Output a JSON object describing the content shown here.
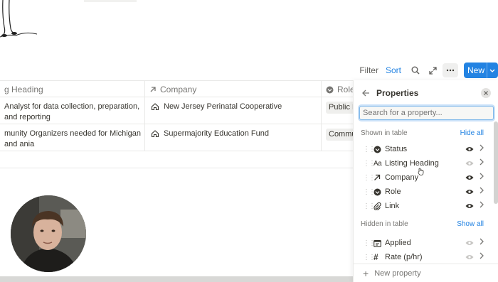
{
  "toolbar": {
    "filter": "Filter",
    "sort": "Sort",
    "new": "New"
  },
  "table": {
    "headers": [
      "g Heading",
      "Company",
      "Role"
    ],
    "rows": [
      {
        "heading": "Analyst for data collection, preparation, and reporting",
        "company": "New Jersey Perinatal Cooperative",
        "role": "Public H"
      },
      {
        "heading": "munity Organizers needed for Michigan and ania",
        "company": "Supermajority Education Fund",
        "role": "Commu"
      }
    ]
  },
  "panel": {
    "title": "Properties",
    "search_placeholder": "Search for a property...",
    "shown_label": "Shown in table",
    "hide_all": "Hide all",
    "hidden_label": "Hidden in table",
    "show_all": "Show all",
    "shown": [
      {
        "name": "Status",
        "icon": "status-icon"
      },
      {
        "name": "Listing Heading",
        "icon": "text-icon"
      },
      {
        "name": "Company",
        "icon": "relation-arrow-icon"
      },
      {
        "name": "Role",
        "icon": "status-icon"
      },
      {
        "name": "Link",
        "icon": "paperclip-icon"
      }
    ],
    "hidden": [
      {
        "name": "Applied",
        "icon": "calendar-icon"
      },
      {
        "name": "Rate (p/hr)",
        "icon": "hash-icon"
      }
    ],
    "new_property": "New property"
  }
}
